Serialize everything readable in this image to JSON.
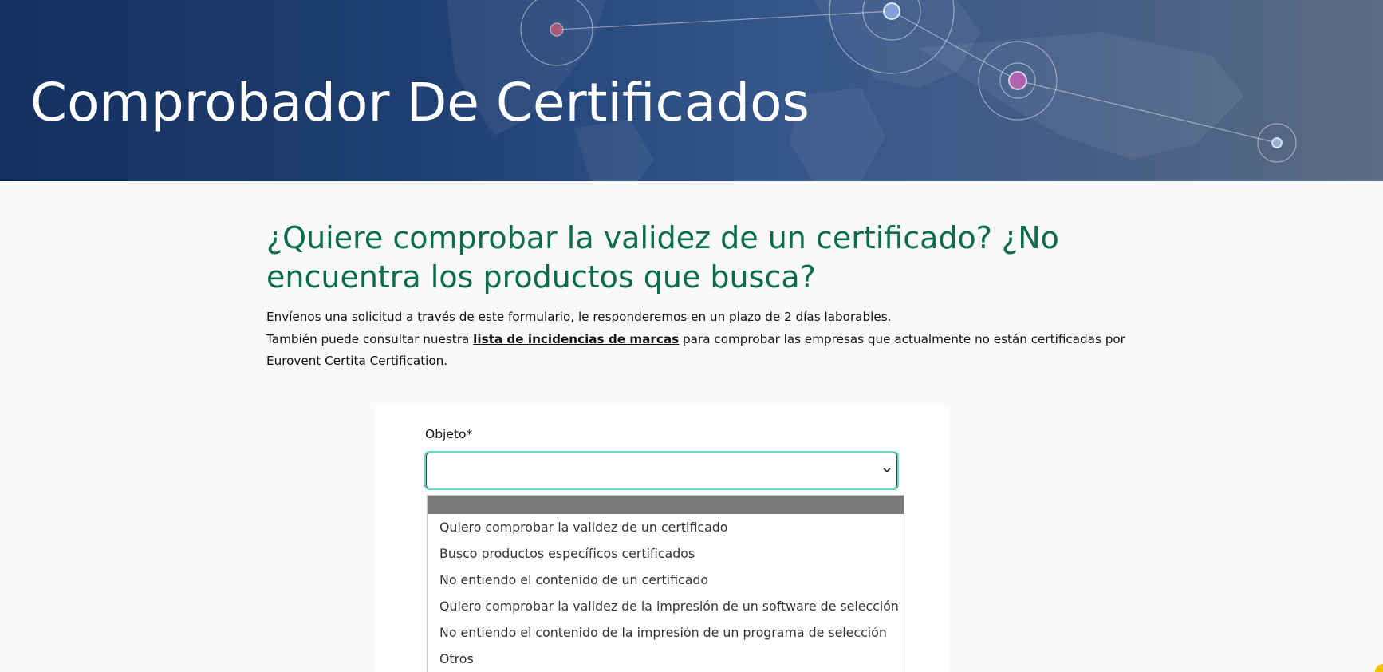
{
  "hero": {
    "title": "Comprobador De Certificados"
  },
  "intro": {
    "heading": "¿Quiere comprobar la validez de un certificado? ¿No encuentra los productos que busca?",
    "line1": "Envíenos una solicitud a través de este formulario, le responderemos en un plazo de 2 días laborables.",
    "line2_before": "También puede consultar nuestra",
    "link_text": "lista de incidencias de marcas",
    "line2_after": "para comprobar las empresas que actualmente no están certificadas por Eurovent Certita Certification."
  },
  "form": {
    "object_label": "Objeto*",
    "object_selected": "",
    "options": [
      "",
      "Quiero comprobar la validez de un certificado",
      "Busco productos específicos certificados",
      "No entiendo el contenido de un certificado",
      "Quiero comprobar la validez de la impresión de un software de selección",
      "No entiendo el contenido de la impresión de un programa de selección",
      "Otros"
    ]
  },
  "colors": {
    "hero_dark": "#14305f",
    "heading_green": "#0b6b4f",
    "focus_ring": "#6fd8c3",
    "dropdown_highlight": "#7a7a7a"
  },
  "icons": {
    "select_arrow": "chevron-down-icon",
    "hero_art": "world-map-network"
  }
}
